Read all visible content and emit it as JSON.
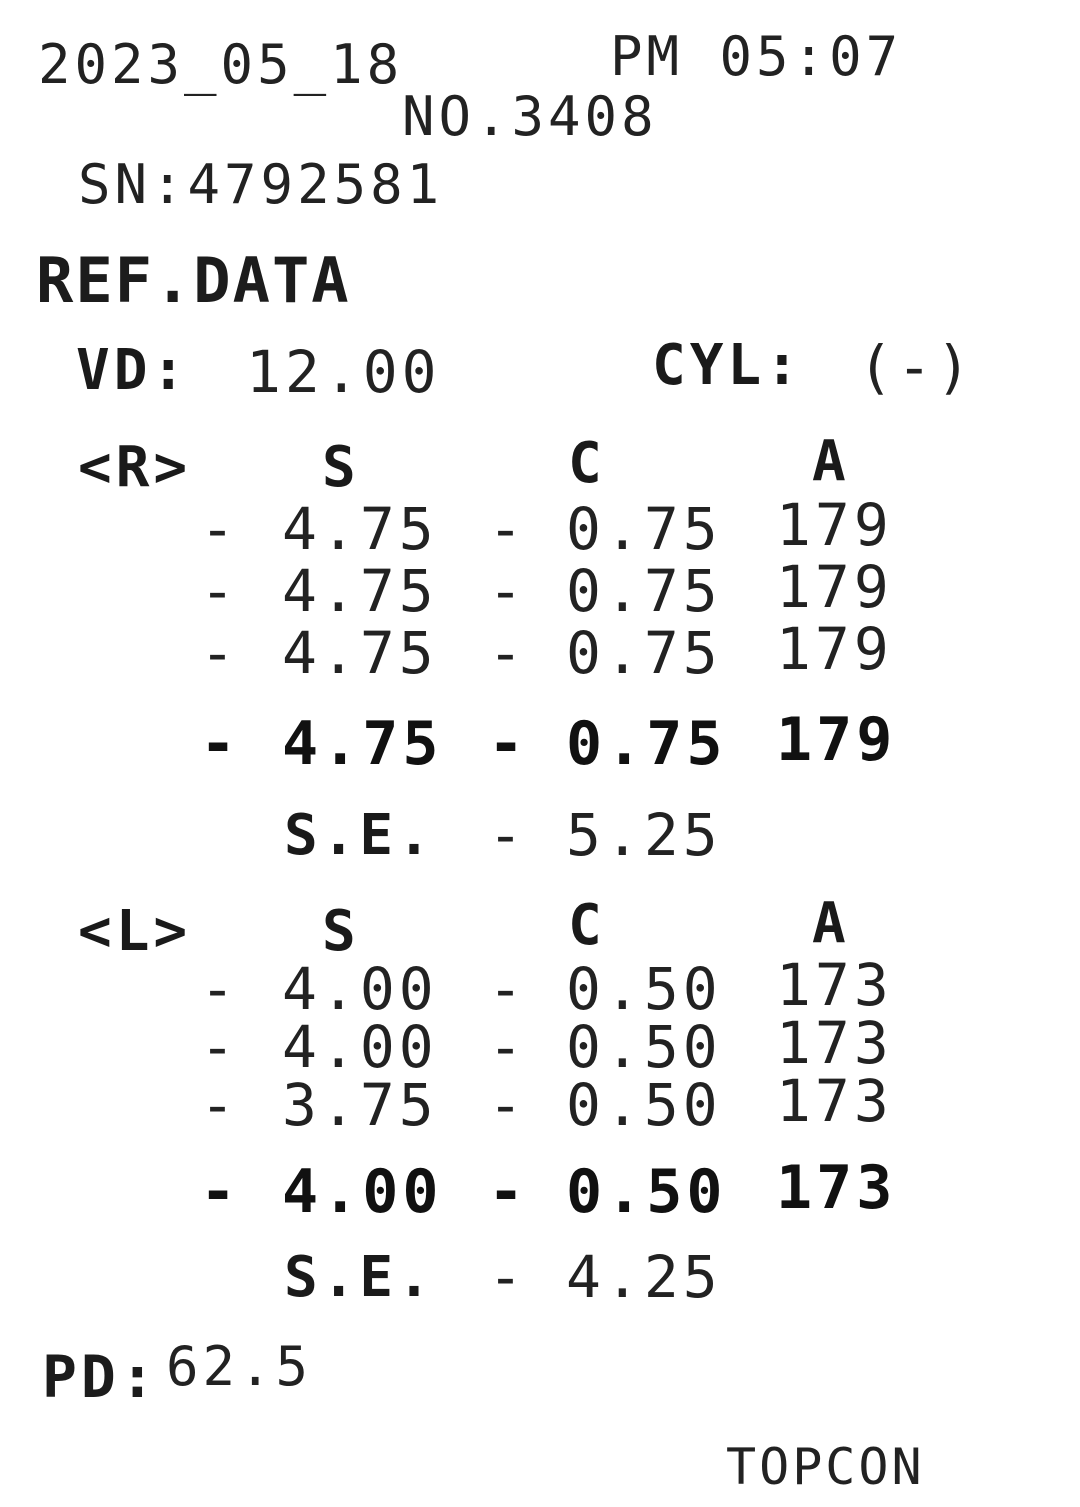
{
  "header": {
    "date": "2023_05_18",
    "time": "PM 05:07",
    "number": "NO.3408",
    "serial": "SN:4792581"
  },
  "title": "REF.DATA",
  "settings": {
    "vd_label": "VD:",
    "vd_value": "12.00",
    "cyl_label": "CYL:",
    "cyl_value": "(-)"
  },
  "columns": {
    "s": "S",
    "c": "C",
    "a": "A"
  },
  "right_eye": {
    "label": "<R>",
    "readings": [
      {
        "s_sign": "-",
        "s": "4.75",
        "c_sign": "-",
        "c": "0.75",
        "a": "179"
      },
      {
        "s_sign": "-",
        "s": "4.75",
        "c_sign": "-",
        "c": "0.75",
        "a": "179"
      },
      {
        "s_sign": "-",
        "s": "4.75",
        "c_sign": "-",
        "c": "0.75",
        "a": "179"
      }
    ],
    "average": {
      "s_sign": "-",
      "s": "4.75",
      "c_sign": "-",
      "c": "0.75",
      "a": "179"
    },
    "se_label": "S.E.",
    "se_sign": "-",
    "se_value": "5.25"
  },
  "left_eye": {
    "label": "<L>",
    "readings": [
      {
        "s_sign": "-",
        "s": "4.00",
        "c_sign": "-",
        "c": "0.50",
        "a": "173"
      },
      {
        "s_sign": "-",
        "s": "4.00",
        "c_sign": "-",
        "c": "0.50",
        "a": "173"
      },
      {
        "s_sign": "-",
        "s": "3.75",
        "c_sign": "-",
        "c": "0.50",
        "a": "173"
      }
    ],
    "average": {
      "s_sign": "-",
      "s": "4.00",
      "c_sign": "-",
      "c": "0.50",
      "a": "173"
    },
    "se_label": "S.E.",
    "se_sign": "-",
    "se_value": "4.25"
  },
  "footer": {
    "pd_label": "PD:",
    "pd_value": "62.5",
    "brand": "TOPCON"
  }
}
